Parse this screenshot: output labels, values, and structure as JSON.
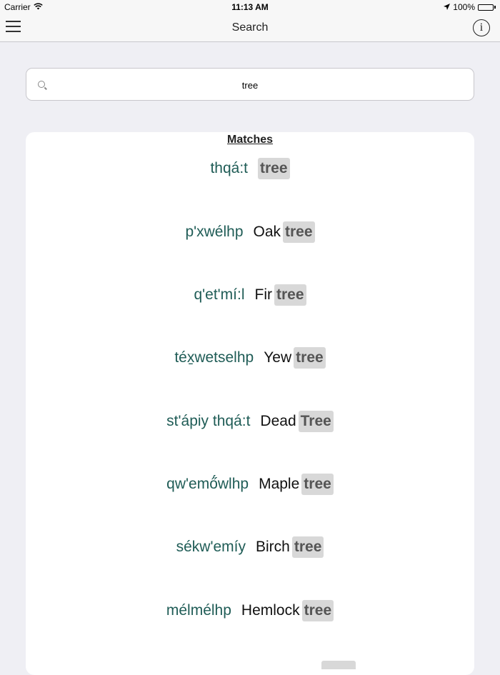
{
  "status_bar": {
    "carrier": "Carrier",
    "time": "11:13 AM",
    "battery": "100%"
  },
  "nav": {
    "title": "Search",
    "info_label": "i"
  },
  "search": {
    "value": "tree"
  },
  "matches": {
    "heading": "Matches",
    "items": [
      {
        "word": "thqá:t",
        "gloss": "",
        "highlight": "tree"
      },
      {
        "word": "p'xwélhp",
        "gloss": "Oak",
        "highlight": "tree"
      },
      {
        "word": "q'et'mí:l",
        "gloss": "Fir",
        "highlight": "tree"
      },
      {
        "word": "téx̱wetselhp",
        "gloss": "Yew",
        "highlight": "tree"
      },
      {
        "word": "st'ápiy thqá:t",
        "gloss": "Dead",
        "highlight": "Tree"
      },
      {
        "word": "qw'emő́wlhp",
        "gloss": "Maple",
        "highlight": "tree"
      },
      {
        "word": "sékw'emíy",
        "gloss": "Birch",
        "highlight": "tree"
      },
      {
        "word": "mélmélhp",
        "gloss": "Hemlock",
        "highlight": "tree"
      }
    ]
  },
  "colors": {
    "word": "#1f5c56",
    "highlight_bg": "#d8d8d8",
    "background": "#efeff4"
  }
}
